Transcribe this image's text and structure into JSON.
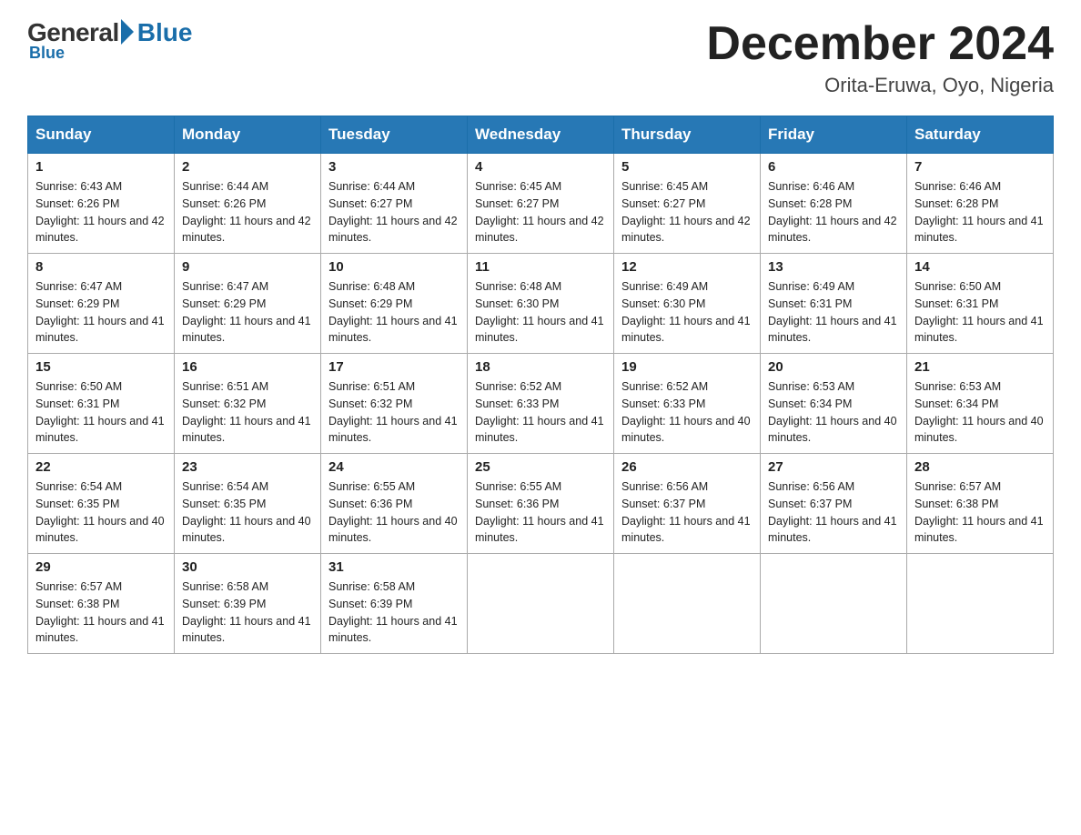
{
  "logo": {
    "general": "General",
    "blue": "Blue"
  },
  "header": {
    "month_year": "December 2024",
    "location": "Orita-Eruwa, Oyo, Nigeria"
  },
  "days_of_week": [
    "Sunday",
    "Monday",
    "Tuesday",
    "Wednesday",
    "Thursday",
    "Friday",
    "Saturday"
  ],
  "weeks": [
    [
      {
        "day": "1",
        "sunrise": "6:43 AM",
        "sunset": "6:26 PM",
        "daylight": "11 hours and 42 minutes."
      },
      {
        "day": "2",
        "sunrise": "6:44 AM",
        "sunset": "6:26 PM",
        "daylight": "11 hours and 42 minutes."
      },
      {
        "day": "3",
        "sunrise": "6:44 AM",
        "sunset": "6:27 PM",
        "daylight": "11 hours and 42 minutes."
      },
      {
        "day": "4",
        "sunrise": "6:45 AM",
        "sunset": "6:27 PM",
        "daylight": "11 hours and 42 minutes."
      },
      {
        "day": "5",
        "sunrise": "6:45 AM",
        "sunset": "6:27 PM",
        "daylight": "11 hours and 42 minutes."
      },
      {
        "day": "6",
        "sunrise": "6:46 AM",
        "sunset": "6:28 PM",
        "daylight": "11 hours and 42 minutes."
      },
      {
        "day": "7",
        "sunrise": "6:46 AM",
        "sunset": "6:28 PM",
        "daylight": "11 hours and 41 minutes."
      }
    ],
    [
      {
        "day": "8",
        "sunrise": "6:47 AM",
        "sunset": "6:29 PM",
        "daylight": "11 hours and 41 minutes."
      },
      {
        "day": "9",
        "sunrise": "6:47 AM",
        "sunset": "6:29 PM",
        "daylight": "11 hours and 41 minutes."
      },
      {
        "day": "10",
        "sunrise": "6:48 AM",
        "sunset": "6:29 PM",
        "daylight": "11 hours and 41 minutes."
      },
      {
        "day": "11",
        "sunrise": "6:48 AM",
        "sunset": "6:30 PM",
        "daylight": "11 hours and 41 minutes."
      },
      {
        "day": "12",
        "sunrise": "6:49 AM",
        "sunset": "6:30 PM",
        "daylight": "11 hours and 41 minutes."
      },
      {
        "day": "13",
        "sunrise": "6:49 AM",
        "sunset": "6:31 PM",
        "daylight": "11 hours and 41 minutes."
      },
      {
        "day": "14",
        "sunrise": "6:50 AM",
        "sunset": "6:31 PM",
        "daylight": "11 hours and 41 minutes."
      }
    ],
    [
      {
        "day": "15",
        "sunrise": "6:50 AM",
        "sunset": "6:31 PM",
        "daylight": "11 hours and 41 minutes."
      },
      {
        "day": "16",
        "sunrise": "6:51 AM",
        "sunset": "6:32 PM",
        "daylight": "11 hours and 41 minutes."
      },
      {
        "day": "17",
        "sunrise": "6:51 AM",
        "sunset": "6:32 PM",
        "daylight": "11 hours and 41 minutes."
      },
      {
        "day": "18",
        "sunrise": "6:52 AM",
        "sunset": "6:33 PM",
        "daylight": "11 hours and 41 minutes."
      },
      {
        "day": "19",
        "sunrise": "6:52 AM",
        "sunset": "6:33 PM",
        "daylight": "11 hours and 40 minutes."
      },
      {
        "day": "20",
        "sunrise": "6:53 AM",
        "sunset": "6:34 PM",
        "daylight": "11 hours and 40 minutes."
      },
      {
        "day": "21",
        "sunrise": "6:53 AM",
        "sunset": "6:34 PM",
        "daylight": "11 hours and 40 minutes."
      }
    ],
    [
      {
        "day": "22",
        "sunrise": "6:54 AM",
        "sunset": "6:35 PM",
        "daylight": "11 hours and 40 minutes."
      },
      {
        "day": "23",
        "sunrise": "6:54 AM",
        "sunset": "6:35 PM",
        "daylight": "11 hours and 40 minutes."
      },
      {
        "day": "24",
        "sunrise": "6:55 AM",
        "sunset": "6:36 PM",
        "daylight": "11 hours and 40 minutes."
      },
      {
        "day": "25",
        "sunrise": "6:55 AM",
        "sunset": "6:36 PM",
        "daylight": "11 hours and 41 minutes."
      },
      {
        "day": "26",
        "sunrise": "6:56 AM",
        "sunset": "6:37 PM",
        "daylight": "11 hours and 41 minutes."
      },
      {
        "day": "27",
        "sunrise": "6:56 AM",
        "sunset": "6:37 PM",
        "daylight": "11 hours and 41 minutes."
      },
      {
        "day": "28",
        "sunrise": "6:57 AM",
        "sunset": "6:38 PM",
        "daylight": "11 hours and 41 minutes."
      }
    ],
    [
      {
        "day": "29",
        "sunrise": "6:57 AM",
        "sunset": "6:38 PM",
        "daylight": "11 hours and 41 minutes."
      },
      {
        "day": "30",
        "sunrise": "6:58 AM",
        "sunset": "6:39 PM",
        "daylight": "11 hours and 41 minutes."
      },
      {
        "day": "31",
        "sunrise": "6:58 AM",
        "sunset": "6:39 PM",
        "daylight": "11 hours and 41 minutes."
      },
      null,
      null,
      null,
      null
    ]
  ]
}
